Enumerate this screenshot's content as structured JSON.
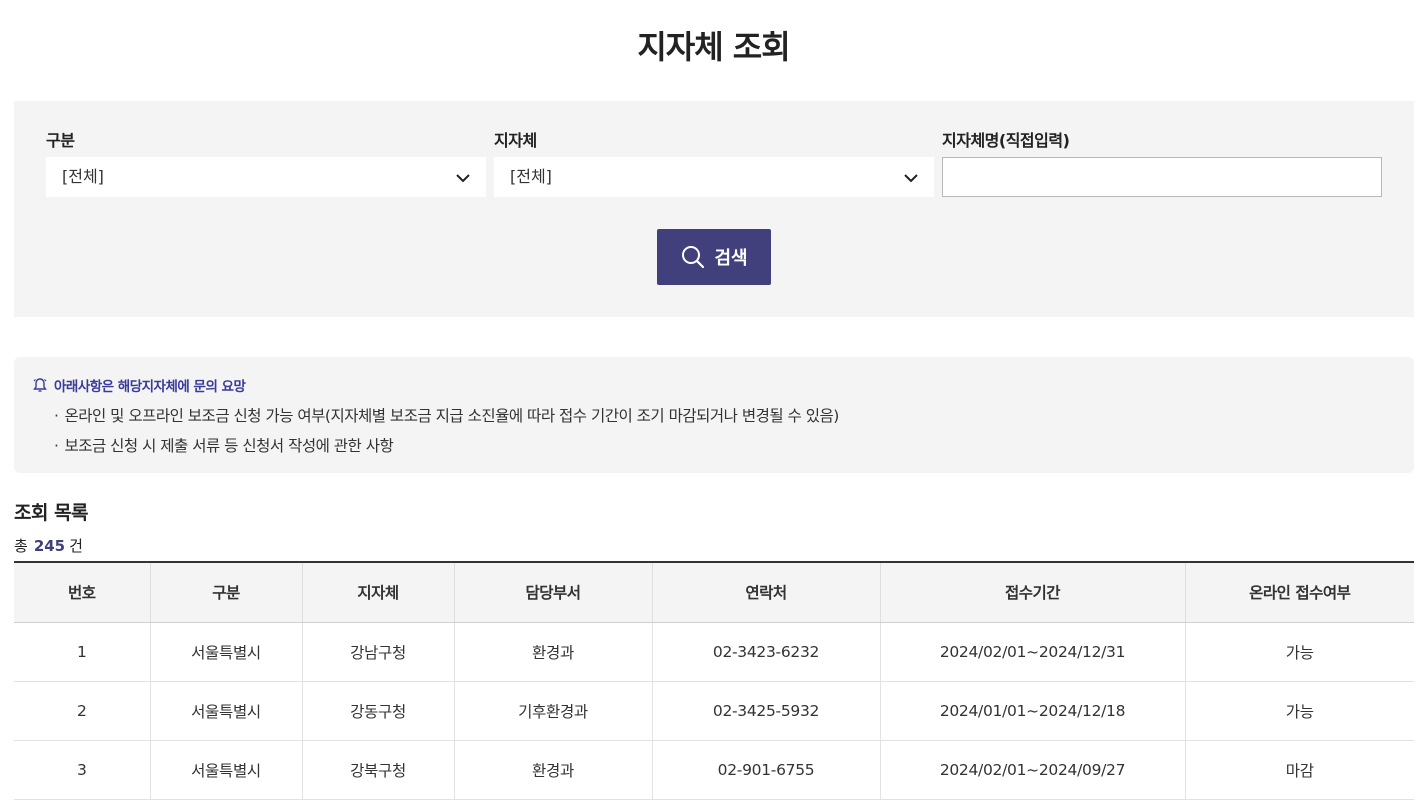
{
  "page": {
    "title": "지자체 조회"
  },
  "search": {
    "category_label": "구분",
    "category_value": "[전체]",
    "region_label": "지자체",
    "region_value": "[전체]",
    "name_label": "지자체명(직접입력)",
    "name_value": "",
    "button_label": "검색"
  },
  "notice": {
    "title": "아래사항은 해당지자체에 문의 요망",
    "items": [
      "온라인 및 오프라인 보조금 신청 가능 여부(지자체별 보조금 지급 소진율에 따라 접수 기간이 조기 마감되거나 변경될 수 있음)",
      "보조금 신청 시 제출 서류 등 신청서 작성에 관한 사항"
    ]
  },
  "results": {
    "title": "조회 목록",
    "total_prefix": "총",
    "total_count": "245",
    "total_suffix": "건",
    "columns": [
      "번호",
      "구분",
      "지자체",
      "담당부서",
      "연락처",
      "접수기간",
      "온라인 접수여부"
    ],
    "rows": [
      [
        "1",
        "서울특별시",
        "강남구청",
        "환경과",
        "02-3423-6232",
        "2024/02/01~2024/12/31",
        "가능"
      ],
      [
        "2",
        "서울특별시",
        "강동구청",
        "기후환경과",
        "02-3425-5932",
        "2024/01/01~2024/12/18",
        "가능"
      ],
      [
        "3",
        "서울특별시",
        "강북구청",
        "환경과",
        "02-901-6755",
        "2024/02/01~2024/09/27",
        "마감"
      ]
    ]
  },
  "colors": {
    "primary": "#41407c",
    "panel_bg": "#f4f4f4",
    "notice_title": "#3a3a9c"
  }
}
